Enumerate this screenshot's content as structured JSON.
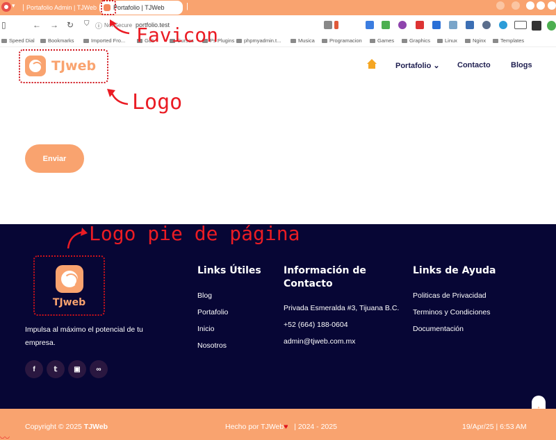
{
  "browser": {
    "tabs": [
      {
        "title": "Portafolio Admin | TJWeb"
      },
      {
        "title": "Portafolio | TJWeb"
      }
    ],
    "url_secure_label": "Not Secure",
    "url": "portfolio.test",
    "bookmarks": [
      "Speed Dial",
      "Bookmarks",
      "Imported Fro...",
      "Gob",
      "Cursos",
      "Ps Plugins",
      "phpmyadmin.t...",
      "Musica",
      "Programacion",
      "Games",
      "Graphics",
      "Linux",
      "Nginx",
      "Templates"
    ]
  },
  "header": {
    "logo_text": "TJweb",
    "nav": {
      "portfolio": "Portafolio",
      "contact": "Contacto",
      "blogs": "Blogs"
    }
  },
  "annotations": {
    "favicon": "Favicon",
    "logo": "Logo",
    "footer_logo": "Logo pie de página"
  },
  "form": {
    "submit_label": "Enviar"
  },
  "footer": {
    "logo_text": "TJweb",
    "about": "Impulsa al máximo el potencial de tu empresa.",
    "social": [
      "facebook-icon",
      "twitter-icon",
      "discord-icon",
      "link-icon"
    ],
    "useful_links": {
      "title": "Links Útiles",
      "items": [
        "Blog",
        "Portafolio",
        "Inicio",
        "Nosotros"
      ]
    },
    "contact": {
      "title": "Información de Contacto",
      "address": "Privada Esmeralda #3, Tijuana B.C.",
      "phone": "+52 (664) 188-0604",
      "email": "admin@tjweb.com.mx"
    },
    "help_links": {
      "title": "Links de Ayuda",
      "items": [
        "Politicas de Privacidad",
        "Terminos y Condiciones",
        "Documentación"
      ]
    }
  },
  "copyright": {
    "prefix": "Copyright © 2025",
    "brand": "TJWeb",
    "made_by": "Hecho por TJWeb",
    "years": "|   2024 - 2025",
    "datetime": "19/Apr/25 | 6:53 AM"
  },
  "colors": {
    "accent": "#f9a36f",
    "footer_bg": "#070635",
    "annotation": "#ea1c24"
  }
}
